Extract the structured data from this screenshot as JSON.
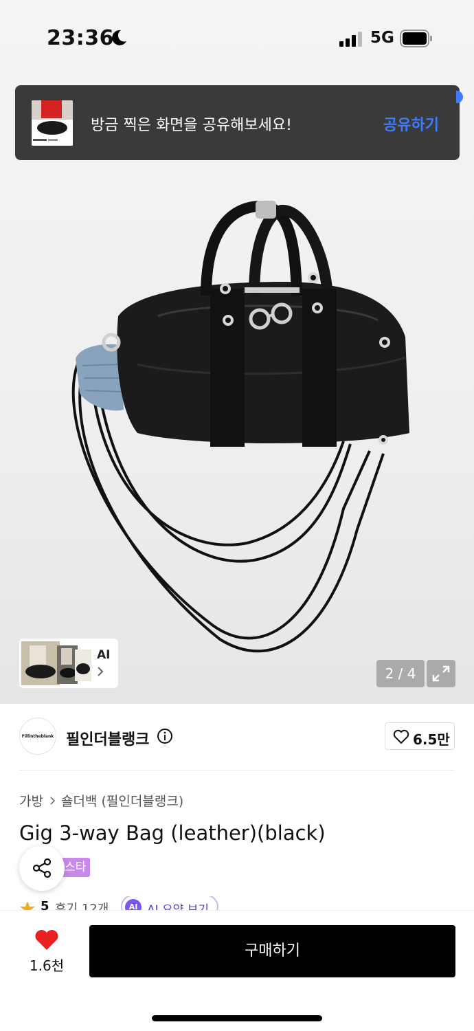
{
  "status_bar": {
    "time": "23:36",
    "network": "5G"
  },
  "toast": {
    "message": "방금 찍은 화면을 공유해보세요!",
    "action_label": "공유하기"
  },
  "gallery": {
    "ai_label": "AI",
    "counter": "2 / 4"
  },
  "brand": {
    "logo_text": "Fillintheblank",
    "name": "필인더블랭크",
    "likes": "6.5만"
  },
  "breadcrumb": {
    "category": "가방",
    "subcategory": "숄더백 (필인더블랭크)"
  },
  "product": {
    "title": "Gig 3-way Bag (leather)(black)",
    "tag": "스타",
    "rating": "5",
    "reviews": "후기 12개",
    "ai_summary_label": "AI 요약 보기"
  },
  "bottom_bar": {
    "wish_count": "1.6천",
    "buy_label": "구매하기"
  },
  "colors": {
    "accent": "#3d7cff",
    "wish_heart": "#e8201f",
    "buy_button": "#000000",
    "tag": "#c78ae8",
    "ai": "#7b57ea"
  }
}
